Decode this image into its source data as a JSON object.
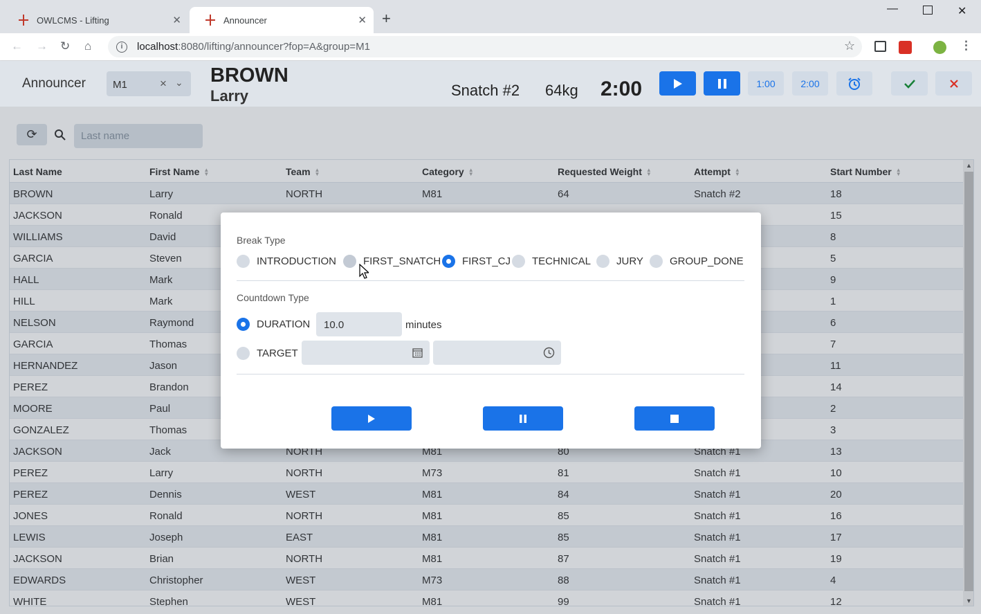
{
  "browser": {
    "tabs": [
      {
        "title": "OWLCMS - Lifting"
      },
      {
        "title": "Announcer"
      }
    ],
    "url_host": "localhost",
    "url_path": ":8080/lifting/announcer?fop=A&group=M1"
  },
  "header": {
    "title": "Announcer",
    "group_value": "M1",
    "lifter_last": "BROWN",
    "lifter_first": "Larry",
    "attempt": "Snatch #2",
    "weight": "64kg",
    "clock": "2:00",
    "btn_1min": "1:00",
    "btn_2min": "2:00"
  },
  "search": {
    "placeholder": "Last name"
  },
  "grid": {
    "columns": [
      "Last Name",
      "First Name",
      "Team",
      "Category",
      "Requested Weight",
      "Attempt",
      "Start Number"
    ],
    "rows": [
      [
        "BROWN",
        "Larry",
        "NORTH",
        "M81",
        "64",
        "Snatch #2",
        "18"
      ],
      [
        "JACKSON",
        "Ronald",
        "",
        "",
        "",
        "",
        "15"
      ],
      [
        "WILLIAMS",
        "David",
        "",
        "",
        "",
        "",
        "8"
      ],
      [
        "GARCIA",
        "Steven",
        "",
        "",
        "",
        "",
        "5"
      ],
      [
        "HALL",
        "Mark",
        "",
        "",
        "",
        "",
        "9"
      ],
      [
        "HILL",
        "Mark",
        "",
        "",
        "",
        "",
        "1"
      ],
      [
        "NELSON",
        "Raymond",
        "",
        "",
        "",
        "",
        "6"
      ],
      [
        "GARCIA",
        "Thomas",
        "",
        "",
        "",
        "",
        "7"
      ],
      [
        "HERNANDEZ",
        "Jason",
        "",
        "",
        "",
        "",
        "11"
      ],
      [
        "PEREZ",
        "Brandon",
        "",
        "",
        "",
        "",
        "14"
      ],
      [
        "MOORE",
        "Paul",
        "",
        "",
        "",
        "",
        "2"
      ],
      [
        "GONZALEZ",
        "Thomas",
        "",
        "",
        "",
        "",
        "3"
      ],
      [
        "JACKSON",
        "Jack",
        "NORTH",
        "M81",
        "80",
        "Snatch #1",
        "13"
      ],
      [
        "PEREZ",
        "Larry",
        "NORTH",
        "M73",
        "81",
        "Snatch #1",
        "10"
      ],
      [
        "PEREZ",
        "Dennis",
        "WEST",
        "M81",
        "84",
        "Snatch #1",
        "20"
      ],
      [
        "JONES",
        "Ronald",
        "NORTH",
        "M81",
        "85",
        "Snatch #1",
        "16"
      ],
      [
        "LEWIS",
        "Joseph",
        "EAST",
        "M81",
        "85",
        "Snatch #1",
        "17"
      ],
      [
        "JACKSON",
        "Brian",
        "NORTH",
        "M81",
        "87",
        "Snatch #1",
        "19"
      ],
      [
        "EDWARDS",
        "Christopher",
        "WEST",
        "M73",
        "88",
        "Snatch #1",
        "4"
      ],
      [
        "WHITE",
        "Stephen",
        "WEST",
        "M81",
        "99",
        "Snatch #1",
        "12"
      ]
    ]
  },
  "dialog": {
    "break_type_label": "Break Type",
    "break_types": [
      "INTRODUCTION",
      "FIRST_SNATCH",
      "FIRST_CJ",
      "TECHNICAL",
      "JURY",
      "GROUP_DONE"
    ],
    "selected_break": "FIRST_CJ",
    "countdown_label": "Countdown Type",
    "duration_label": "DURATION",
    "duration_value": "10.0",
    "duration_unit": "minutes",
    "target_label": "TARGET",
    "selected_countdown": "DURATION"
  },
  "colors": {
    "accent": "#1a73e8",
    "header_bg": "#dfe4ea",
    "cancel_red": "#d93025",
    "confirm_green": "#188038"
  }
}
